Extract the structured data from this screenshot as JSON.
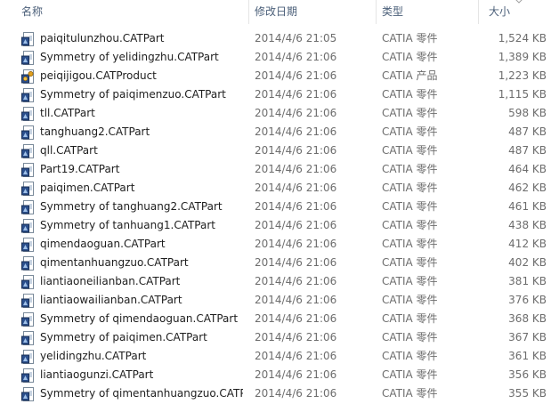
{
  "header": {
    "name_label": "名称",
    "date_label": "修改日期",
    "type_label": "类型",
    "size_label": "大小"
  },
  "colors": {
    "header_text": "#4c607a",
    "detail_text": "#6d6d6d",
    "name_text": "#1e1e1e",
    "hover": "#e5f3ff"
  },
  "files": [
    {
      "name": "paiqitulunzhou.CATPart",
      "date": "2014/4/6 21:05",
      "type": "CATIA 零件",
      "size": "1,524 KB",
      "icon": "catpart-icon"
    },
    {
      "name": "Symmetry of yelidingzhu.CATPart",
      "date": "2014/4/6 21:06",
      "type": "CATIA 零件",
      "size": "1,389 KB",
      "icon": "catpart-icon"
    },
    {
      "name": "peiqijigou.CATProduct",
      "date": "2014/4/6 21:06",
      "type": "CATIA 产品",
      "size": "1,223 KB",
      "icon": "catproduct-icon"
    },
    {
      "name": "Symmetry of paiqimenzuo.CATPart",
      "date": "2014/4/6 21:06",
      "type": "CATIA 零件",
      "size": "1,115 KB",
      "icon": "catpart-icon"
    },
    {
      "name": "tll.CATPart",
      "date": "2014/4/6 21:06",
      "type": "CATIA 零件",
      "size": "598 KB",
      "icon": "catpart-icon"
    },
    {
      "name": "tanghuang2.CATPart",
      "date": "2014/4/6 21:06",
      "type": "CATIA 零件",
      "size": "487 KB",
      "icon": "catpart-icon"
    },
    {
      "name": "qll.CATPart",
      "date": "2014/4/6 21:06",
      "type": "CATIA 零件",
      "size": "487 KB",
      "icon": "catpart-icon"
    },
    {
      "name": "Part19.CATPart",
      "date": "2014/4/6 21:06",
      "type": "CATIA 零件",
      "size": "464 KB",
      "icon": "catpart-icon"
    },
    {
      "name": "paiqimen.CATPart",
      "date": "2014/4/6 21:06",
      "type": "CATIA 零件",
      "size": "462 KB",
      "icon": "catpart-icon"
    },
    {
      "name": "Symmetry of tanghuang2.CATPart",
      "date": "2014/4/6 21:06",
      "type": "CATIA 零件",
      "size": "461 KB",
      "icon": "catpart-icon"
    },
    {
      "name": "Symmetry of tanhuang1.CATPart",
      "date": "2014/4/6 21:06",
      "type": "CATIA 零件",
      "size": "438 KB",
      "icon": "catpart-icon"
    },
    {
      "name": "qimendaoguan.CATPart",
      "date": "2014/4/6 21:06",
      "type": "CATIA 零件",
      "size": "412 KB",
      "icon": "catpart-icon"
    },
    {
      "name": "qimentanhuangzuo.CATPart",
      "date": "2014/4/6 21:06",
      "type": "CATIA 零件",
      "size": "402 KB",
      "icon": "catpart-icon"
    },
    {
      "name": "liantiaoneilianban.CATPart",
      "date": "2014/4/6 21:06",
      "type": "CATIA 零件",
      "size": "381 KB",
      "icon": "catpart-icon"
    },
    {
      "name": "liantiaowailianban.CATPart",
      "date": "2014/4/6 21:06",
      "type": "CATIA 零件",
      "size": "376 KB",
      "icon": "catpart-icon"
    },
    {
      "name": "Symmetry of qimendaoguan.CATPart",
      "date": "2014/4/6 21:06",
      "type": "CATIA 零件",
      "size": "368 KB",
      "icon": "catpart-icon"
    },
    {
      "name": "Symmetry of paiqimen.CATPart",
      "date": "2014/4/6 21:06",
      "type": "CATIA 零件",
      "size": "367 KB",
      "icon": "catpart-icon"
    },
    {
      "name": "yelidingzhu.CATPart",
      "date": "2014/4/6 21:06",
      "type": "CATIA 零件",
      "size": "361 KB",
      "icon": "catpart-icon"
    },
    {
      "name": "liantiaogunzi.CATPart",
      "date": "2014/4/6 21:06",
      "type": "CATIA 零件",
      "size": "356 KB",
      "icon": "catpart-icon"
    },
    {
      "name": "Symmetry of qimentanhuangzuo.CATPart",
      "date": "2014/4/6 21:06",
      "type": "CATIA 零件",
      "size": "355 KB",
      "icon": "catpart-icon"
    }
  ]
}
